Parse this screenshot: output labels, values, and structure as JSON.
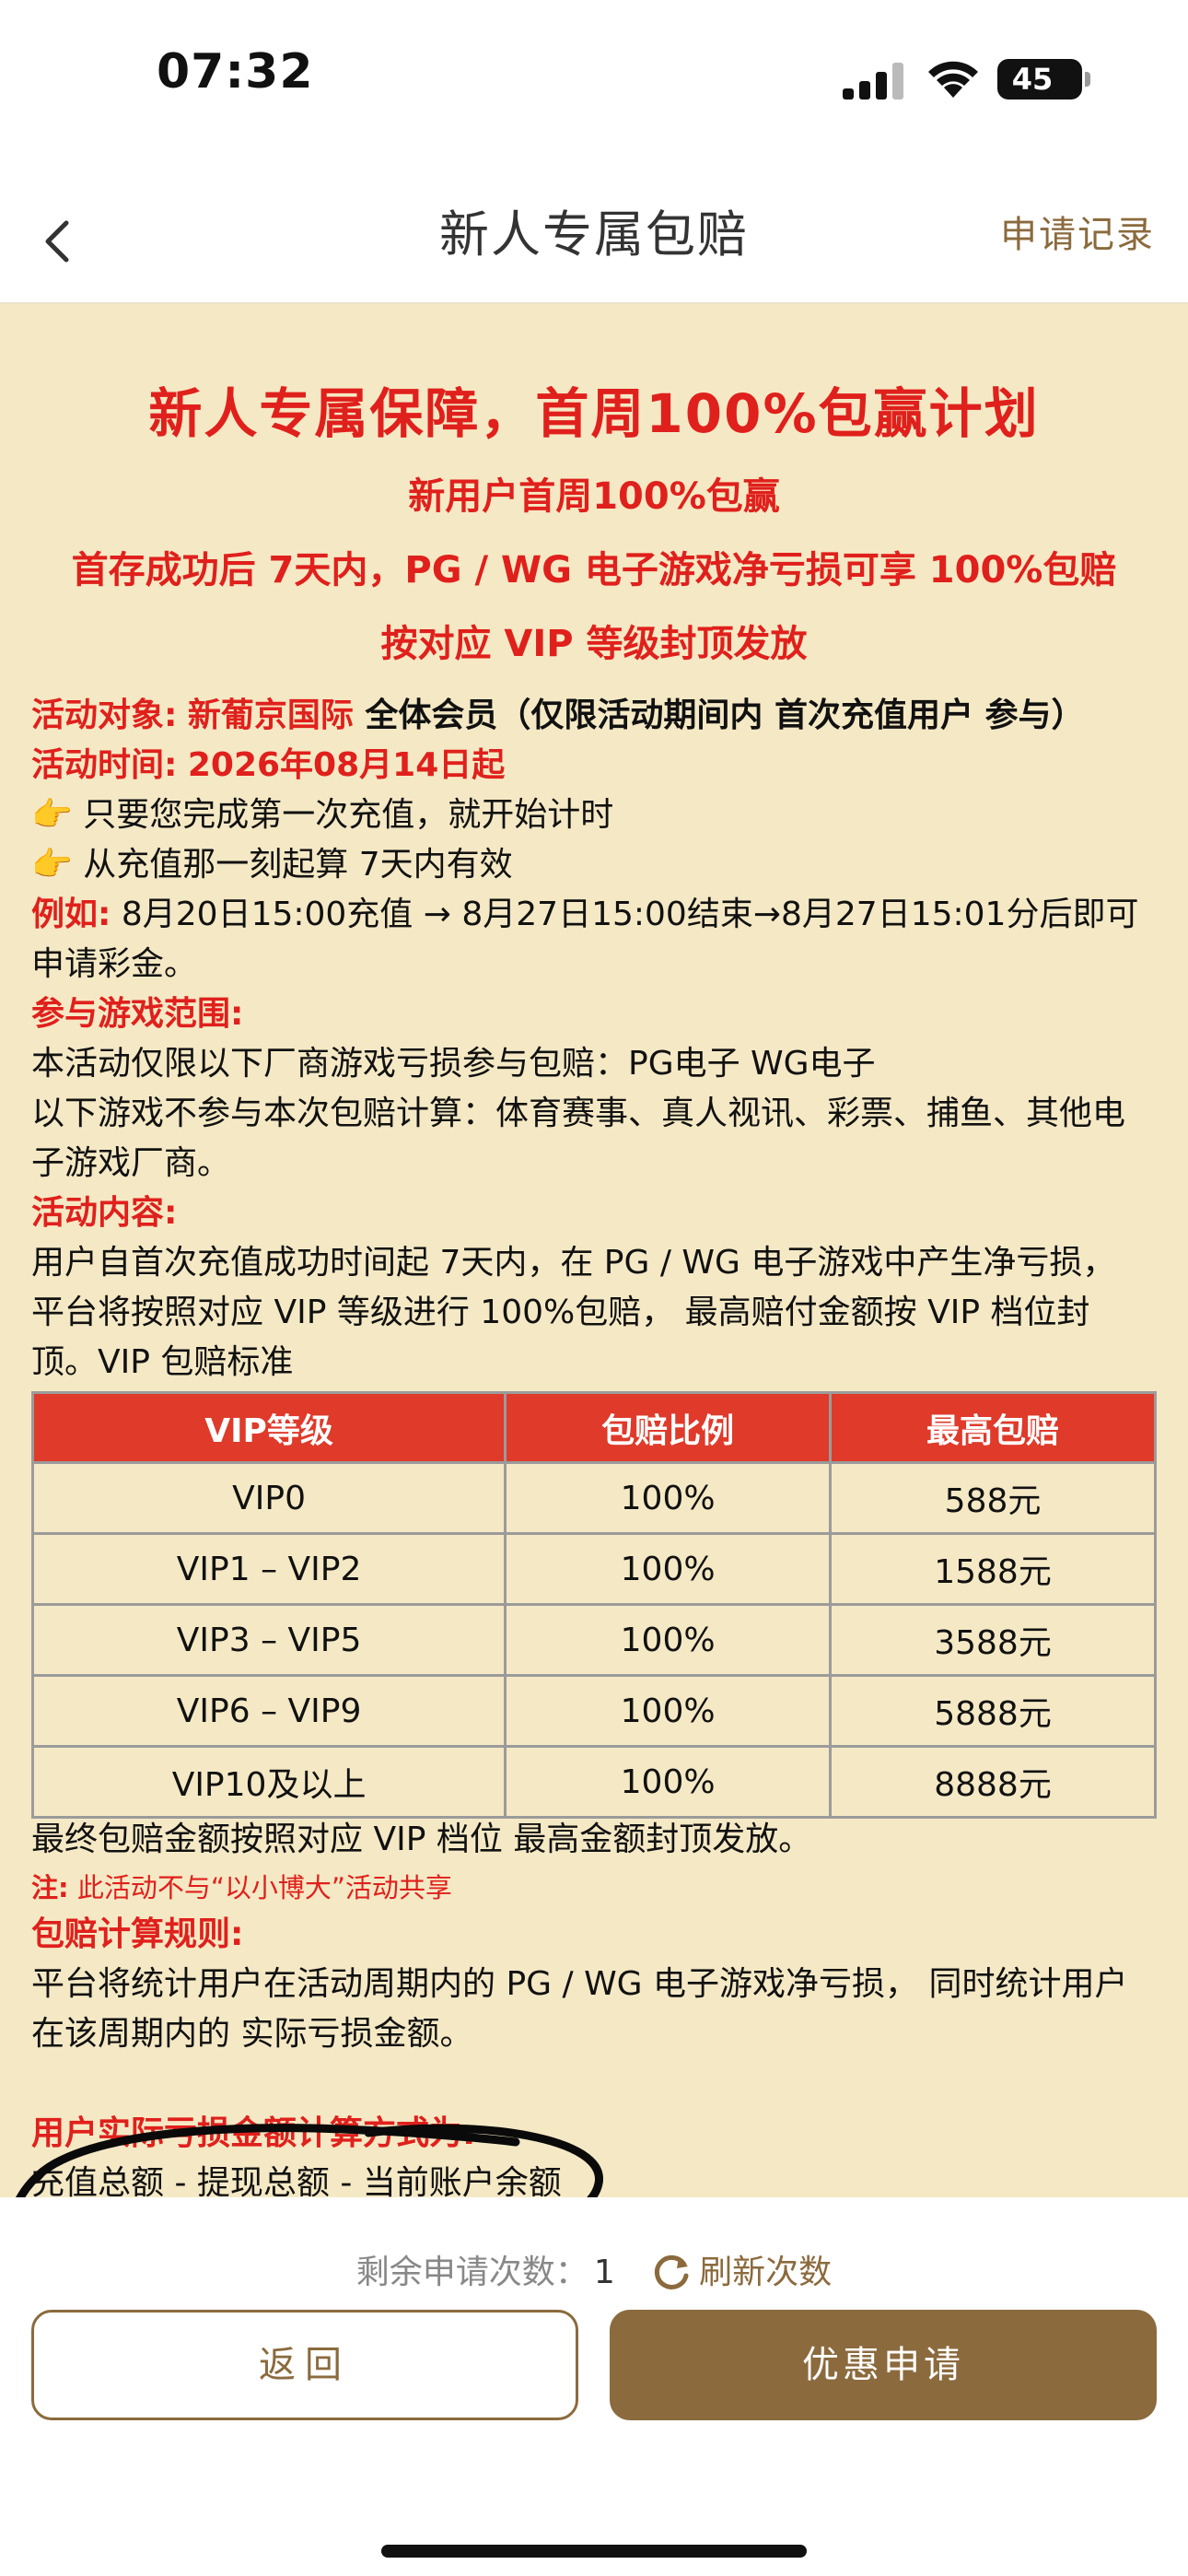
{
  "status_bar": {
    "time": "07:32",
    "battery": "45"
  },
  "nav": {
    "title": "新人专属包赔",
    "right_link": "申请记录"
  },
  "hero": {
    "title": "新人专属保障，首周100%包赢计划",
    "line1": "新用户首周100%包赢",
    "line2": "首存成功后 7天内，PG / WG 电子游戏净亏损可享 100%包赔",
    "line3": "按对应 VIP 等级封顶发放"
  },
  "info": {
    "target_label": "活动对象:",
    "target_brand": "新葡京国际",
    "target_text": " 全体会员（仅限活动期间内 首次充值用户 参与）",
    "time_label": "活动时间:",
    "time_value": "2026年08月14日起",
    "tip1_icon": "👉",
    "tip1": " 只要您完成第一次充值，就开始计时",
    "tip2_icon": "👉",
    "tip2": " 从充值那一刻起算 7天内有效",
    "example_label": "例如:",
    "example_text1": " 8月20日15:00充值 → 8月27日15:00结束→8月27日15:01分后即可",
    "example_text2": "申请彩金。",
    "scope_label": "参与游戏范围:",
    "scope_text1": "本活动仅限以下厂商游戏亏损参与包赔：PG电子 WG电子",
    "scope_text2": "以下游戏不参与本次包赔计算：体育赛事、真人视讯、彩票、捕鱼、其他电",
    "scope_text3": "子游戏厂商。",
    "content_label": "活动内容:",
    "content_text1": "用户自首次充值成功时间起 7天内，在 PG / WG 电子游戏中产生净亏损，",
    "content_text2": "平台将按照对应 VIP 等级进行 100%包赔， 最高赔付金额按 VIP 档位封",
    "content_text3": "顶。VIP 包赔标准"
  },
  "table": {
    "headers": [
      "VIP等级",
      "包赔比例",
      "最高包赔"
    ],
    "rows": [
      [
        "VIP0",
        "100%",
        "588元"
      ],
      [
        "VIP1 – VIP2",
        "100%",
        "1588元"
      ],
      [
        "VIP3 – VIP5",
        "100%",
        "3588元"
      ],
      [
        "VIP6 – VIP9",
        "100%",
        "5888元"
      ],
      [
        "VIP10及以上",
        "100%",
        "8888元"
      ]
    ]
  },
  "after_table": {
    "final_text": "最终包赔金额按照对应 VIP 档位 最高金额封顶发放。",
    "note_label": "注:",
    "note_text": " 此活动不与“以小博大”活动共享",
    "rule_label": "包赔计算规则:",
    "rule_text1": "平台将统计用户在活动周期内的 PG / WG 电子游戏净亏损， 同时统计用户",
    "rule_text2": "在该周期内的 实际亏损金额。",
    "calc_label": "用户实际亏损金额计算方式为:",
    "calc_text": "充值总额 - 提现总额 - 当前账户余额"
  },
  "bottom": {
    "remain_label": "剩余申请次数：",
    "remain_count": "1",
    "refresh_label": "刷新次数",
    "back_button": "返回",
    "apply_button": "优惠申请"
  },
  "colors": {
    "accent_red": "#e0201c",
    "brand_brown": "#8b6a3d",
    "content_bg": "#f5e9c5",
    "table_header": "#df3a2a"
  }
}
